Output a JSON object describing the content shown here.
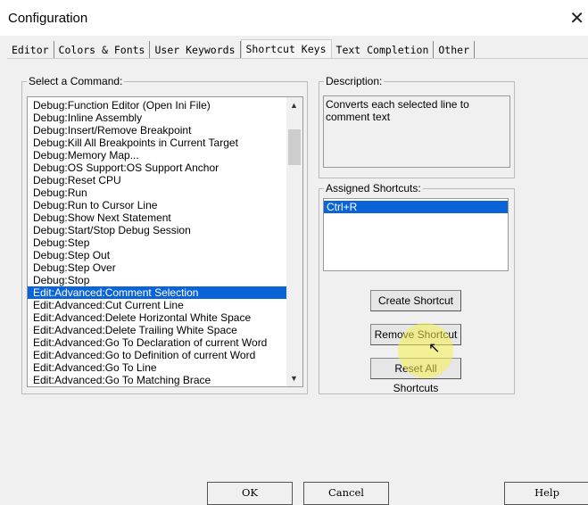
{
  "window": {
    "title": "Configuration",
    "close_icon": "close-icon"
  },
  "tabs": [
    "Editor",
    "Colors & Fonts",
    "User Keywords",
    "Shortcut Keys",
    "Text Completion",
    "Other"
  ],
  "active_tab": 3,
  "commands": {
    "label": "Select a Command:",
    "selected_index": 15,
    "items": [
      "Debug:Function Editor (Open Ini File)",
      "Debug:Inline Assembly",
      "Debug:Insert/Remove Breakpoint",
      "Debug:Kill All Breakpoints in Current Target",
      "Debug:Memory Map...",
      "Debug:OS Support:OS Support Anchor",
      "Debug:Reset CPU",
      "Debug:Run",
      "Debug:Run to Cursor Line",
      "Debug:Show Next Statement",
      "Debug:Start/Stop Debug Session",
      "Debug:Step",
      "Debug:Step Out",
      "Debug:Step Over",
      "Debug:Stop",
      "Edit:Advanced:Comment Selection",
      "Edit:Advanced:Cut Current Line",
      "Edit:Advanced:Delete Horizontal White Space",
      "Edit:Advanced:Delete Trailing White Space",
      "Edit:Advanced:Go To Declaration of current Word",
      "Edit:Advanced:Go to Definition of current Word",
      "Edit:Advanced:Go To Line",
      "Edit:Advanced:Go To Matching Brace"
    ]
  },
  "description": {
    "label": "Description:",
    "text": "Converts each selected line to comment text"
  },
  "assigned": {
    "label": "Assigned Shortcuts:",
    "items": [
      "Ctrl+R"
    ]
  },
  "buttons": {
    "create": "Create Shortcut",
    "remove": "Remove Shortcut",
    "reset": "Reset All Shortcuts"
  },
  "footer": {
    "ok": "OK",
    "cancel": "Cancel",
    "help": "Help"
  },
  "colors": {
    "selection": "#0a64d8"
  }
}
